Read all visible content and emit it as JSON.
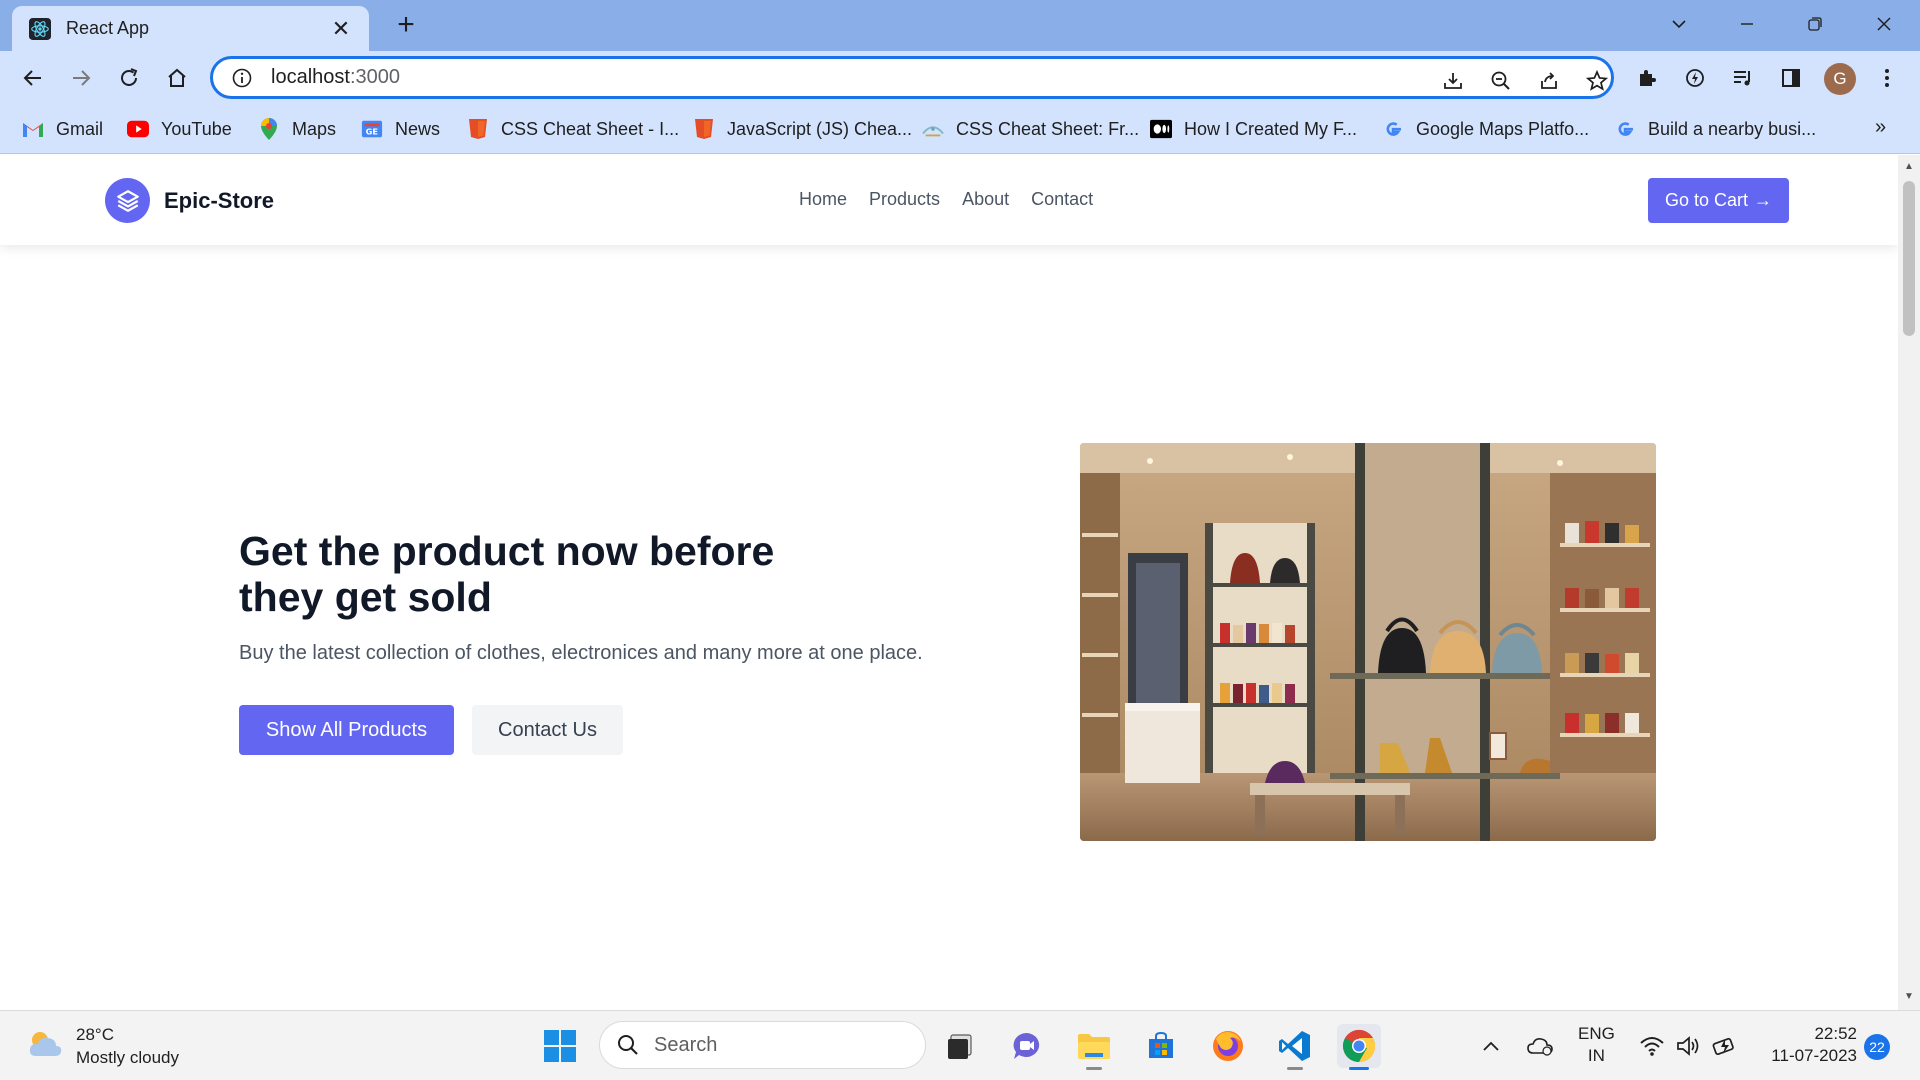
{
  "browser": {
    "tab_title": "React App",
    "tab_close": "✕",
    "new_tab": "+",
    "url_host": "localhost",
    "url_port": ":3000",
    "profile_initial": "G",
    "bookmarks_more": "»",
    "bookmarks": [
      {
        "label": "Gmail",
        "icon": "gmail-icon"
      },
      {
        "label": "YouTube",
        "icon": "youtube-icon"
      },
      {
        "label": "Maps",
        "icon": "maps-icon"
      },
      {
        "label": "News",
        "icon": "news-icon"
      },
      {
        "label": "CSS Cheat Sheet - I...",
        "icon": "html5-icon"
      },
      {
        "label": "JavaScript (JS) Chea...",
        "icon": "html5-icon"
      },
      {
        "label": "CSS Cheat Sheet: Fr...",
        "icon": "site-icon"
      },
      {
        "label": "How I Created My F...",
        "icon": "medium-icon"
      },
      {
        "label": "Google Maps Platfo...",
        "icon": "google-icon"
      },
      {
        "label": "Build a nearby busi...",
        "icon": "google-icon"
      }
    ]
  },
  "site": {
    "brand": "Epic-Store",
    "nav": [
      "Home",
      "Products",
      "About",
      "Contact"
    ],
    "cart_button": "Go to Cart",
    "cart_arrow": "→",
    "hero_title_line1": "Get the product now before",
    "hero_title_line2": "they get sold",
    "hero_subtitle": "Buy the latest collection of clothes, electronices and many more at one place.",
    "primary_button": "Show All Products",
    "secondary_button": "Contact Us",
    "accent_color": "#6366f1"
  },
  "taskbar": {
    "temperature": "28°C",
    "weather": "Mostly cloudy",
    "search_placeholder": "Search",
    "lang_line1": "ENG",
    "lang_line2": "IN",
    "time": "22:52",
    "date": "11-07-2023",
    "notification_count": "22",
    "tray_chevron": "^"
  }
}
